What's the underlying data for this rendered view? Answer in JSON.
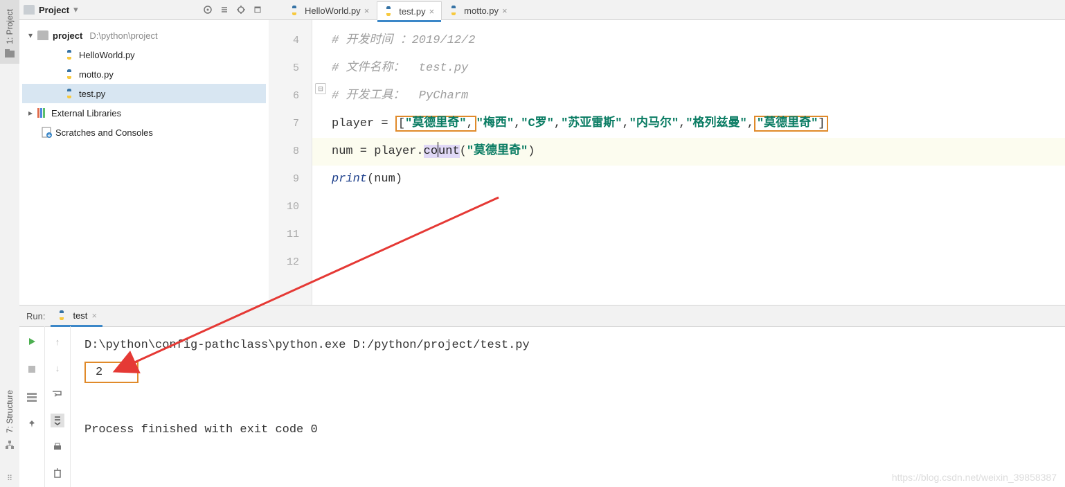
{
  "left_strip": {
    "project": "1: Project",
    "structure": "7: Structure"
  },
  "project_panel": {
    "title": "Project",
    "root_name": "project",
    "root_path": "D:\\python\\project",
    "files": [
      "HelloWorld.py",
      "motto.py",
      "test.py"
    ],
    "ext_libs": "External Libraries",
    "scratches": "Scratches and Consoles"
  },
  "tabs": [
    {
      "label": "HelloWorld.py",
      "active": false
    },
    {
      "label": "test.py",
      "active": true
    },
    {
      "label": "motto.py",
      "active": false
    }
  ],
  "editor": {
    "line_numbers": [
      "4",
      "5",
      "6",
      "7",
      "8",
      "9",
      "10",
      "11",
      "12"
    ],
    "comment_dev_time": "# 开发时间 ：2019/12/2",
    "comment_file_name": "# 文件名称：  test.py",
    "comment_tool": "# 开发工具：  PyCharm",
    "line7": {
      "var": "player",
      "eq": " = ",
      "br_o": "[",
      "s1": "\"莫德里奇\"",
      "c": ",",
      "s2": "\"梅西\"",
      "s3": "\"C罗\"",
      "s4": "\"苏亚雷斯\"",
      "s5": "\"内马尔\"",
      "s6": "\"格列兹曼\"",
      "s7": "\"莫德里奇\"",
      "br_c": "]"
    },
    "line8": {
      "var": "num",
      "eq": " = player.",
      "call_a": "co",
      "call_b": "unt",
      "open": "(",
      "arg": "\"莫德里奇\"",
      "close": ")"
    },
    "line9": {
      "fn": "print",
      "open": "(",
      "arg": "num",
      "close": ")"
    }
  },
  "run": {
    "label": "Run:",
    "tab_label": "test",
    "cmd": "D:\\python\\config-pathclass\\python.exe D:/python/project/test.py",
    "output": "2",
    "exit": "Process finished with exit code 0"
  },
  "watermark": "https://blog.csdn.net/weixin_39858387"
}
